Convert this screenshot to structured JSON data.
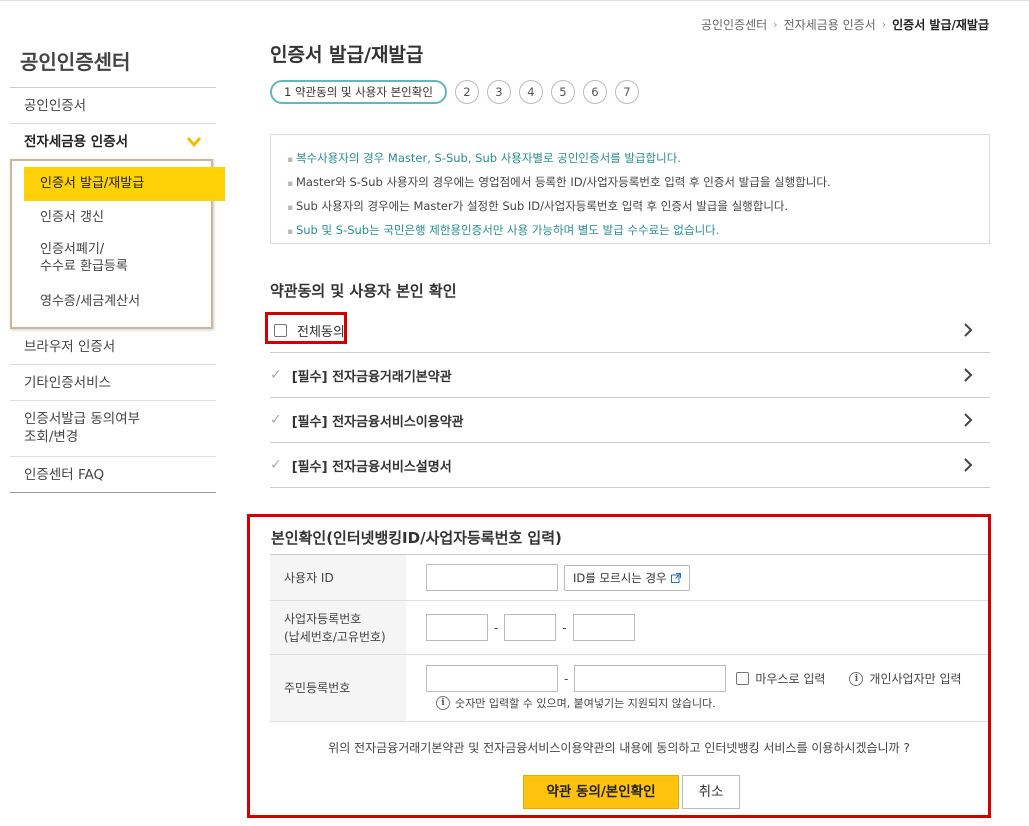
{
  "breadcrumb": [
    "공인인증센터",
    "전자세금용 인증서",
    "인증서 발급/재발급"
  ],
  "sidebar": {
    "title": "공인인증센터",
    "items": [
      {
        "label": "공인인증서"
      },
      {
        "label": "전자세금용 인증서"
      },
      {
        "label": "브라우저 인증서"
      },
      {
        "label": "기타인증서비스"
      },
      {
        "label": "인증서발급 동의여부\n조회/변경"
      },
      {
        "label": "인증센터 FAQ"
      }
    ],
    "submenu": [
      {
        "label": "인증서 발급/재발급"
      },
      {
        "label": "인증서 갱신"
      },
      {
        "label": "인증서폐기/\n수수료 환급등록"
      },
      {
        "label": "영수증/세금계산서"
      }
    ]
  },
  "main": {
    "title": "인증서 발급/재발급",
    "steps": {
      "active": "1 약관동의 및 사용자 본인확인",
      "others": [
        "2",
        "3",
        "4",
        "5",
        "6",
        "7"
      ]
    },
    "notices": [
      "복수사용자의 경우 Master, S-Sub, Sub 사용자별로 공인인증서를 발급합니다.",
      "Master와 S-Sub 사용자의 경우에는 영업점에서 등록한 ID/사업자등록번호 입력 후 인증서 발급을 실행합니다.",
      "Sub 사용자의 경우에는 Master가 설정한 Sub ID/사업자등록번호 입력 후 인증서 발급을 실행합니다.",
      "Sub 및 S-Sub는 국민은행 제한용인증서만 사용 가능하며 별도 발급 수수료는 없습니다."
    ],
    "terms_title": "약관동의 및 사용자 본인 확인",
    "agree_all": "전체동의",
    "terms": [
      "[필수] 전자금융거래기본약관",
      "[필수] 전자금융서비스이용약관",
      "[필수] 전자금융서비스설명서"
    ]
  },
  "identity": {
    "title": "본인확인(인터넷뱅킹ID/사업자등록번호 입력)",
    "user_id_label": "사용자 ID",
    "find_id_button": "ID를 모르시는 경우",
    "biz_label": "사업자등록번호\n(납세번호/고유번호)",
    "rrn_label": "주민등록번호",
    "mouse_input": "마우스로 입력",
    "personal_only": "개인사업자만 입력",
    "hint": "숫자만 입력할 수 있으며, 붙여넣기는 지원되지 않습니다.",
    "dash": "-",
    "question": "위의 전자금융거래기본약관 및 전자금융서비스이용약관의 내용에 동의하고 인터넷뱅킹 서비스를 이용하시겠습니까 ?",
    "confirm_button": "약관 동의/본인확인",
    "cancel_button": "취소"
  },
  "colors": {
    "accent": "#ffd208",
    "step_border": "#62b7b8",
    "highlight": "#d40000",
    "notice_teal": "#2a8c8f"
  }
}
